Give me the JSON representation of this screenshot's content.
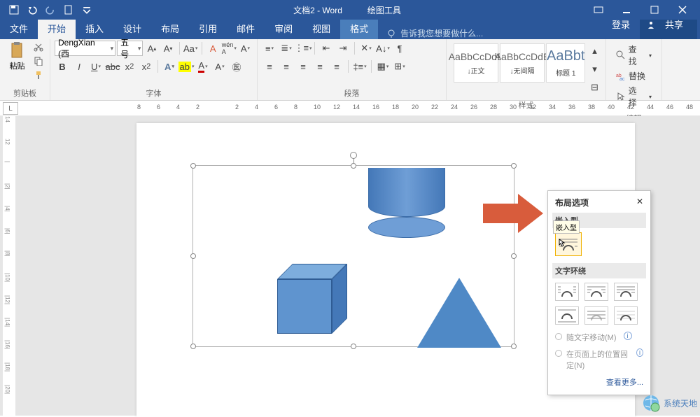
{
  "title": {
    "doc": "文档2 - Word",
    "tool_tab": "绘图工具"
  },
  "tabs": {
    "file": "文件",
    "home": "开始",
    "insert": "插入",
    "design": "设计",
    "layout": "布局",
    "references": "引用",
    "mailings": "邮件",
    "review": "审阅",
    "view": "视图",
    "format": "格式"
  },
  "tellme": "告诉我您想要做什么...",
  "account": {
    "signin": "登录",
    "share": "共享"
  },
  "ribbon": {
    "clipboard": {
      "paste": "粘贴",
      "label": "剪贴板"
    },
    "font": {
      "name": "DengXian (西",
      "size": "五号",
      "label": "字体"
    },
    "para": {
      "label": "段落"
    },
    "styles": {
      "label": "样式",
      "preview": "AaBbCcDdE",
      "preview_big": "AaBbt",
      "s1": "↓正文",
      "s2": "↓无间隔",
      "s3": "标题 1"
    },
    "editing": {
      "find": "查找",
      "replace": "替换",
      "select": "选择",
      "label": "编辑"
    }
  },
  "ruler": {
    "marks": [
      "8",
      "6",
      "4",
      "2",
      "",
      "2",
      "4",
      "6",
      "8",
      "10",
      "12",
      "14",
      "16",
      "18",
      "20",
      "22",
      "24",
      "26",
      "28",
      "30",
      "32",
      "34",
      "36",
      "38",
      "40",
      "42",
      "44",
      "46",
      "48"
    ]
  },
  "vruler": [
    "14",
    "12",
    "|",
    "|2|",
    "|4|",
    "|6|",
    "|8|",
    "|10|",
    "|12|",
    "|14|",
    "|16|",
    "|18|",
    "|20|"
  ],
  "selector": "L",
  "popup": {
    "title": "布局选项",
    "inline": "嵌入型",
    "tooltip": "嵌入型",
    "wrap": "文字环绕",
    "opt1": "随文字移动(M)",
    "opt2": "在页面上的位置固定(N)",
    "more": "查看更多..."
  },
  "watermark": "系统天地"
}
